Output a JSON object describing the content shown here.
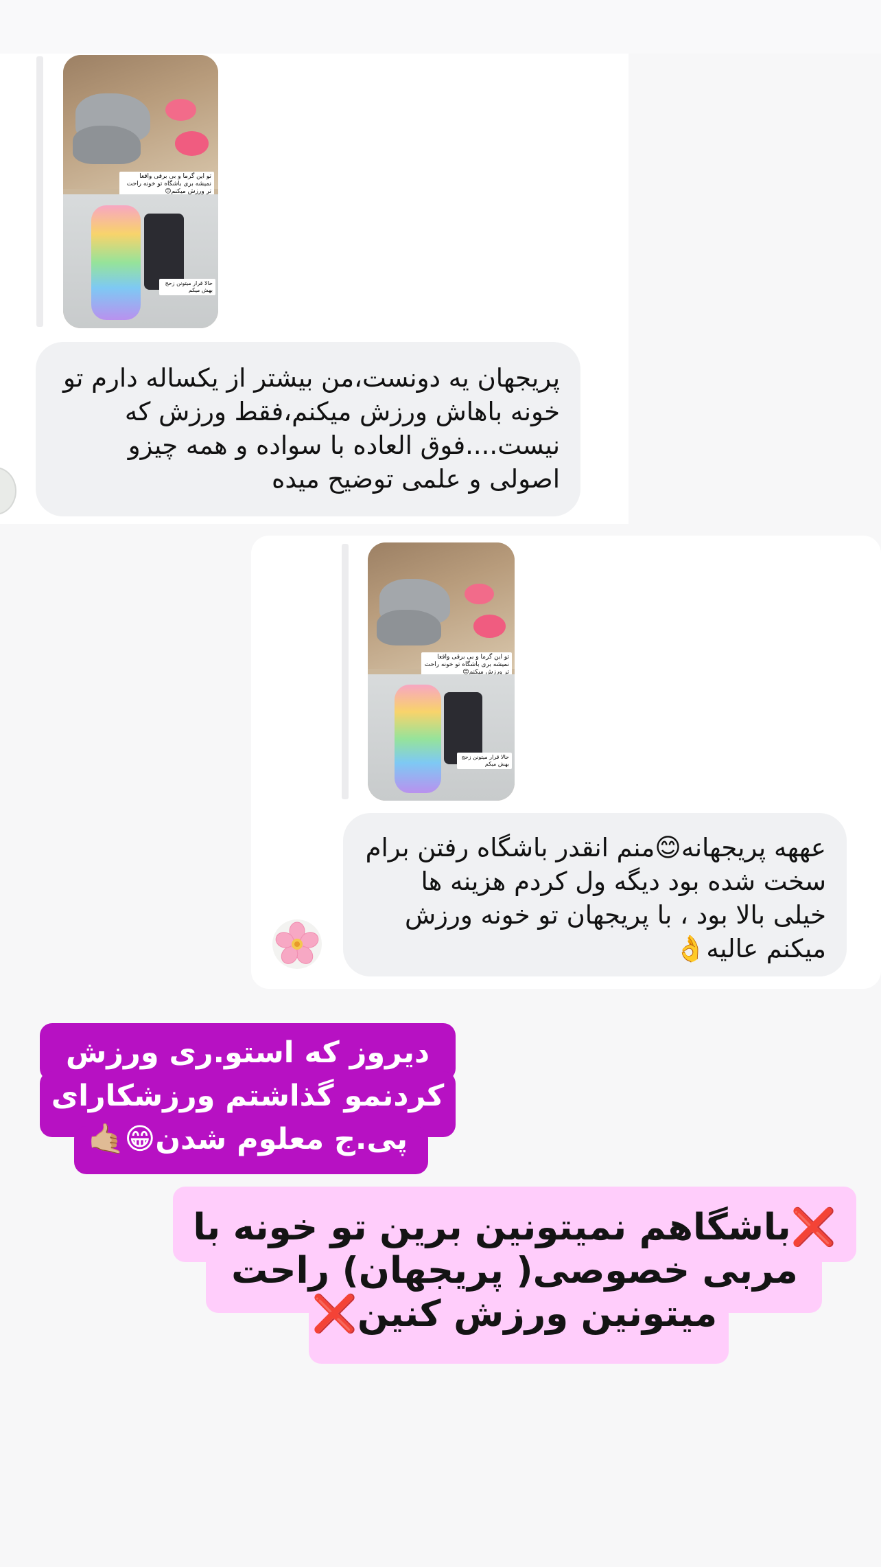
{
  "messages": [
    {
      "shared_image_captions": [
        "تو این گرما و بی برقی واقعا نمیشه بری باشگاه تو خونه راحت تر ورزش میکنم😊",
        "حالا قرار میتونن زحج بهش میکم"
      ],
      "text": "پریجهان یه دونست،من بیشتر از یکساله دارم تو خونه باهاش ورزش میکنم،فقط ورزش که نیست....فوق العاده با سواده و همه چیزو اصولی و علمی توضیح میده"
    },
    {
      "shared_image_captions": [
        "تو این گرما و بی برقی واقعا نمیشه بری باشگاه تو خونه راحت تر ورزش میکنم😊",
        "حالا قرار میتونن زحج بهش میکم"
      ],
      "text": "عههه پریجهانه😊منم انقدر باشگاه رفتن برام سخت شده بود دیگه ول کردم هزینه ها خیلی بالا بود ، با پریجهان تو خونه ورزش میکنم عالیه👌",
      "avatar_icon": "cherry-blossom-icon"
    }
  ],
  "story_text": {
    "line1": "دیروز که استو.ری ورزش",
    "line2": "کردنمو گذاشتم ورزشکارای",
    "line3": "پی.ج معلوم شدن😁🤙🏼"
  },
  "promo_text": {
    "line1_mark": "❌",
    "line1": "باشگاهم نمیتونین برین تو خونه با",
    "line2": "مربی خصوصی( پریجهان) راحت",
    "line3": "میتونین ورزش کنین",
    "line3_mark": "❌"
  },
  "colors": {
    "story_background": "#b711c3",
    "promo_background": "#ffcdfb",
    "bubble_background": "#f0f1f3",
    "x_mark": "#e31d2a"
  }
}
